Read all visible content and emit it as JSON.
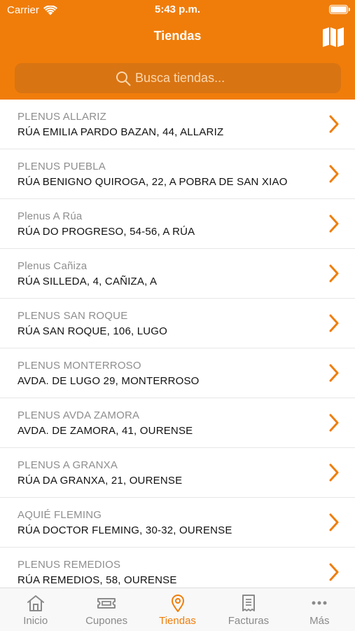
{
  "status": {
    "carrier": "Carrier",
    "time": "5:43 p.m."
  },
  "header": {
    "title": "Tiendas",
    "map_icon": "map-icon"
  },
  "search": {
    "placeholder": "Busca tiendas..."
  },
  "stores": [
    {
      "name": "PLENUS ALLARIZ",
      "address": "RÚA EMILIA PARDO BAZAN, 44, ALLARIZ"
    },
    {
      "name": "PLENUS PUEBLA",
      "address": "RÚA BENIGNO QUIROGA, 22, A POBRA DE SAN XIAO"
    },
    {
      "name": "Plenus A Rúa",
      "address": "RÚA DO PROGRESO, 54-56, A RÚA"
    },
    {
      "name": "Plenus Cañiza",
      "address": "RÚA SILLEDA, 4, CAÑIZA, A"
    },
    {
      "name": "PLENUS SAN ROQUE",
      "address": "RÚA SAN ROQUE, 106, LUGO"
    },
    {
      "name": "PLENUS MONTERROSO",
      "address": "AVDA. DE LUGO 29, MONTERROSO"
    },
    {
      "name": "PLENUS AVDA ZAMORA",
      "address": "AVDA. DE ZAMORA, 41, OURENSE"
    },
    {
      "name": "PLENUS A GRANXA",
      "address": "RÚA DA GRANXA, 21, OURENSE"
    },
    {
      "name": "AQUIÉ FLEMING",
      "address": "RÚA DOCTOR FLEMING, 30-32, OURENSE"
    },
    {
      "name": "PLENUS REMEDIOS",
      "address": "RÚA REMEDIOS, 58, OURENSE"
    }
  ],
  "tabs": [
    {
      "label": "Inicio",
      "icon": "home-icon",
      "active": false
    },
    {
      "label": "Cupones",
      "icon": "ticket-icon",
      "active": false
    },
    {
      "label": "Tiendas",
      "icon": "location-pin-icon",
      "active": true
    },
    {
      "label": "Facturas",
      "icon": "receipt-icon",
      "active": false
    },
    {
      "label": "Más",
      "icon": "more-dots-icon",
      "active": false
    }
  ],
  "colors": {
    "brand": "#f07d0a",
    "inactive": "#8a8a8a"
  }
}
